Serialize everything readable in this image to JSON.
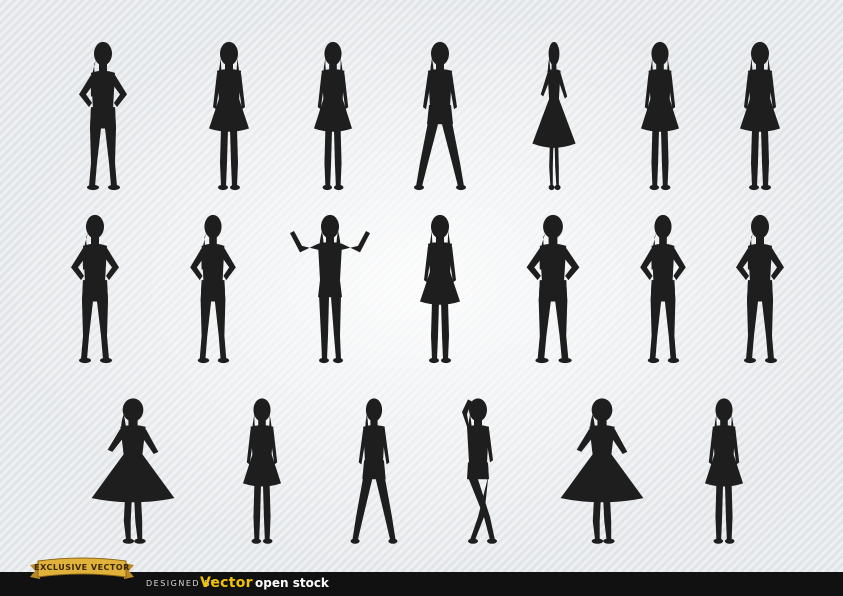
{
  "footer": {
    "designed_by": "DESIGNED BY",
    "brand_main": "Vector",
    "brand_rest": "open stock",
    "badge": "EXCLUSIVE VECTOR"
  },
  "silhouette": {
    "count": 20,
    "fill": "#1e1e1e"
  },
  "colors": {
    "background": "#e9ecef",
    "footer_bar": "#111111",
    "brand": "#f2c200",
    "badge_gold": "#e0b23a"
  }
}
